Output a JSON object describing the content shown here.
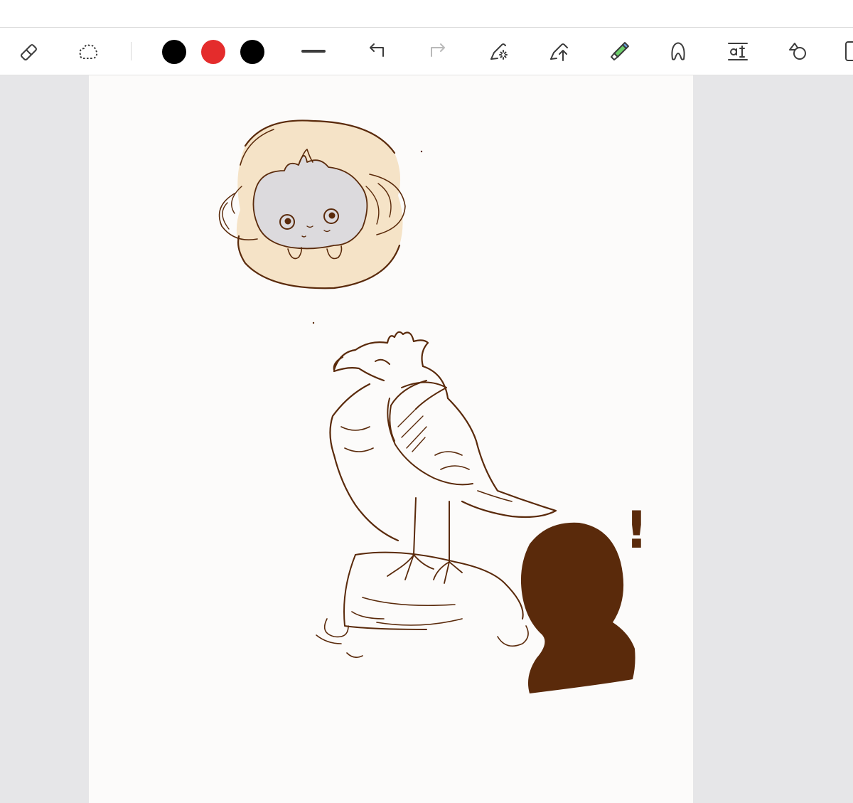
{
  "window": {
    "title": ""
  },
  "toolbar": {
    "tools": [
      {
        "name": "eraser",
        "icon": "eraser-icon"
      },
      {
        "name": "lasso",
        "icon": "lasso-icon"
      },
      {
        "name": "pen-width",
        "icon": "stroke-width-icon"
      },
      {
        "name": "undo",
        "icon": "undo-icon"
      },
      {
        "name": "redo",
        "icon": "redo-icon",
        "enabled": false
      },
      {
        "name": "image-sparkle",
        "icon": "magic-pen-icon"
      },
      {
        "name": "upload",
        "icon": "upload-pen-icon"
      },
      {
        "name": "highlighter",
        "icon": "highlighter-icon"
      },
      {
        "name": "shape-recognizer",
        "icon": "blob-shape-icon"
      },
      {
        "name": "text",
        "icon": "text-tool-icon"
      },
      {
        "name": "shapes",
        "icon": "shapes-icon"
      },
      {
        "name": "page",
        "icon": "page-icon"
      }
    ],
    "colors": [
      "#000000",
      "#e42c2c",
      "#000000"
    ],
    "stroke_color": "#3c3c3c"
  },
  "canvas": {
    "ink_color": "#5a2a0b",
    "thought_fill": "#f5e3c7",
    "creature_fill": "#dcdadd",
    "annotation": "!"
  }
}
